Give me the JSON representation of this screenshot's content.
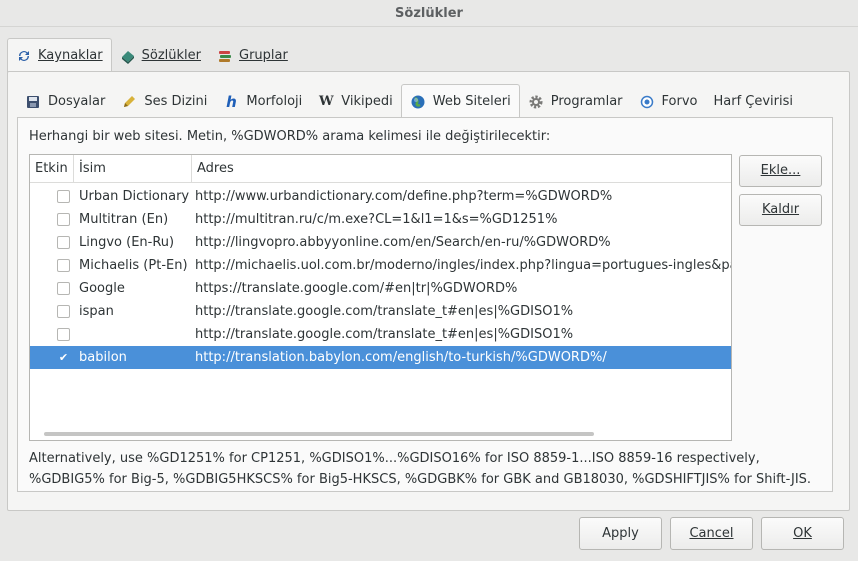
{
  "window": {
    "title": "Sözlükler"
  },
  "main_tabs": [
    {
      "label": "Kaynaklar",
      "icon": "refresh-icon",
      "active": true
    },
    {
      "label": "Sözlükler",
      "icon": "book-icon",
      "active": false
    },
    {
      "label": "Gruplar",
      "icon": "books-stack-icon",
      "active": false
    }
  ],
  "sub_tabs": [
    {
      "label": "Dosyalar",
      "icon": "disk-icon",
      "active": false
    },
    {
      "label": "Ses Dizini",
      "icon": "pencil-icon",
      "active": false
    },
    {
      "label": "Morfoloji",
      "icon": "h-icon",
      "active": false
    },
    {
      "label": "Vikipedi",
      "icon": "wikipedia-icon",
      "active": false
    },
    {
      "label": "Web Siteleri",
      "icon": "globe-icon",
      "active": true
    },
    {
      "label": "Programlar",
      "icon": "gear-icon",
      "active": false
    },
    {
      "label": "Forvo",
      "icon": "forvo-icon",
      "active": false
    },
    {
      "label": "Harf Çevirisi",
      "icon": "",
      "active": false
    }
  ],
  "web_sites": {
    "hint": "Herhangi bir web sitesi. Metin, %GDWORD% arama kelimesi ile değiştirilecektir:",
    "columns": [
      "Etkin",
      "İsim",
      "Adres"
    ],
    "rows": [
      {
        "enabled": false,
        "name": "Urban Dictionary",
        "address": "http://www.urbandictionary.com/define.php?term=%GDWORD%"
      },
      {
        "enabled": false,
        "name": "Multitran (En)",
        "address": "http://multitran.ru/c/m.exe?CL=1&l1=1&s=%GD1251%"
      },
      {
        "enabled": false,
        "name": "Lingvo (En-Ru)",
        "address": "http://lingvopro.abbyyonline.com/en/Search/en-ru/%GDWORD%"
      },
      {
        "enabled": false,
        "name": "Michaelis (Pt-En)",
        "address": "http://michaelis.uol.com.br/moderno/ingles/index.php?lingua=portugues-ingles&pa"
      },
      {
        "enabled": false,
        "name": "Google",
        "address": "https://translate.google.com/#en|tr|%GDWORD%"
      },
      {
        "enabled": false,
        "name": "ispan",
        "address": "http://translate.google.com/translate_t#en|es|%GDISO1%"
      },
      {
        "enabled": false,
        "name": "",
        "address": "http://translate.google.com/translate_t#en|es|%GDISO1%"
      },
      {
        "enabled": true,
        "name": "babilon",
        "address": "http://translation.babylon.com/english/to-turkish/%GDWORD%/",
        "selected": true
      }
    ],
    "add_button": "Ekle...",
    "remove_button": "Kaldır",
    "note_line1": "Alternatively, use %GD1251% for CP1251, %GDISO1%...%GDISO16% for ISO 8859-1...ISO 8859-16 respectively,",
    "note_line2": "%GDBIG5% for Big-5, %GDBIG5HKSCS% for Big5-HKSCS, %GDGBK% for GBK and GB18030, %GDSHIFTJIS% for Shift-JIS."
  },
  "footer": {
    "apply": "Apply",
    "cancel": "Cancel",
    "ok": "OK"
  },
  "colors": {
    "selection": "#4a90d9",
    "background": "#e8e8e7"
  }
}
